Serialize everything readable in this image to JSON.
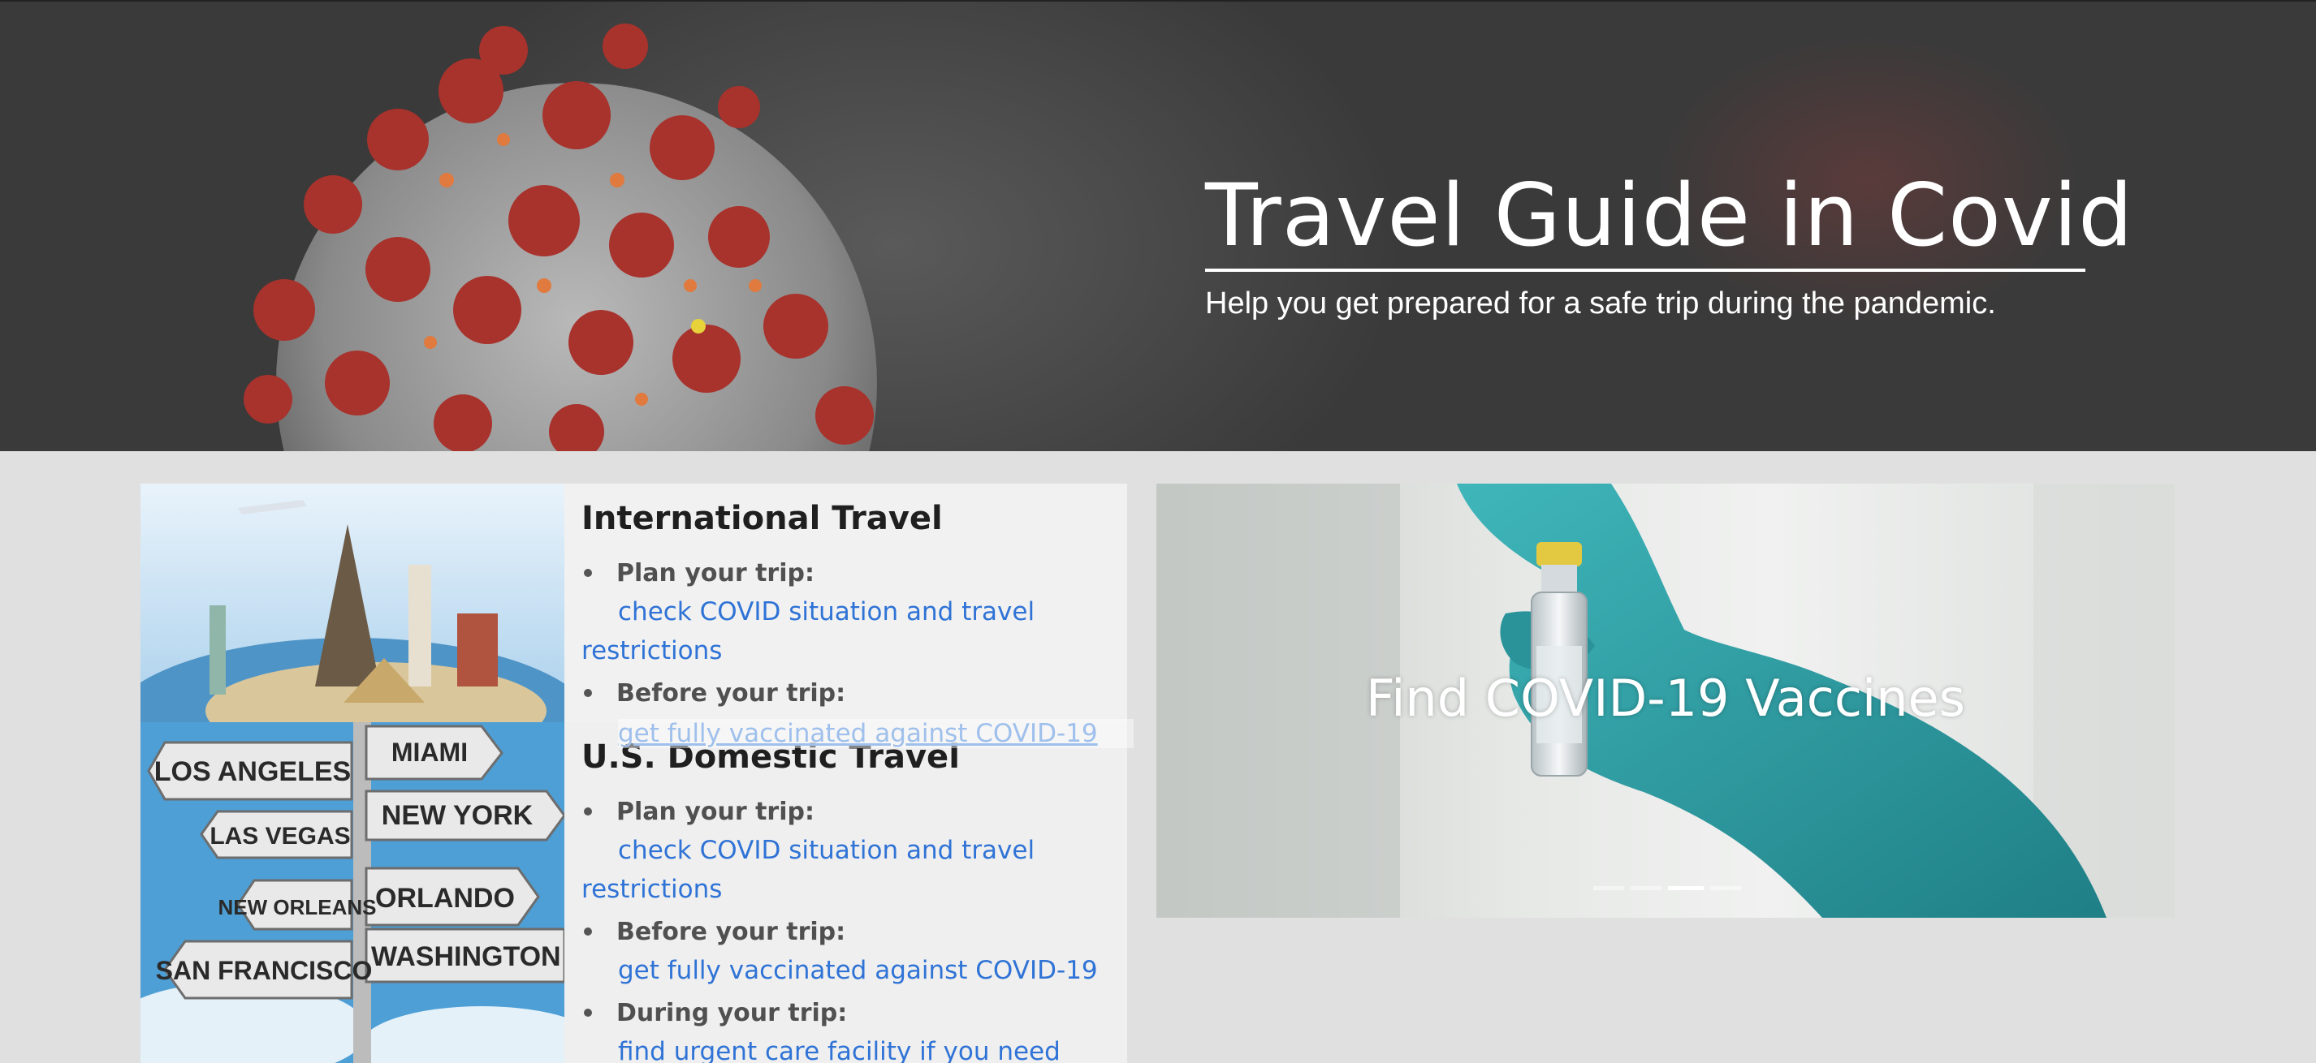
{
  "hero": {
    "title": "Travel Guide in Covid",
    "subtitle": "Help you get prepared for a safe trip during the pandemic."
  },
  "international": {
    "title": "International Travel",
    "items": [
      {
        "label": "Plan your trip:",
        "link": "check COVID situation and travel restrictions"
      },
      {
        "label": "Before your trip:",
        "link": "get fully vaccinated against COVID-19"
      }
    ]
  },
  "domestic": {
    "title": "U.S. Domestic Travel",
    "items": [
      {
        "label": "Plan your trip:",
        "link": "check COVID situation and travel restrictions"
      },
      {
        "label": "Before your trip:",
        "link": "get fully vaccinated against COVID-19"
      },
      {
        "label": "During your trip:",
        "link": "find urgent care facility if you need help"
      }
    ]
  },
  "vaccine": {
    "title": "Find COVID-19 Vaccines",
    "slides": 4,
    "active_slide": 3
  },
  "signs": [
    "LOS ANGELES",
    "MIAMI",
    "LAS VEGAS",
    "NEW YORK",
    "NEW ORLEANS",
    "ORLANDO",
    "SAN FRANCISCO",
    "WASHINGTON"
  ],
  "colors": {
    "link": "#2f73d6",
    "virus_spike": "#a8322c",
    "glove": "#2b9fa4"
  }
}
